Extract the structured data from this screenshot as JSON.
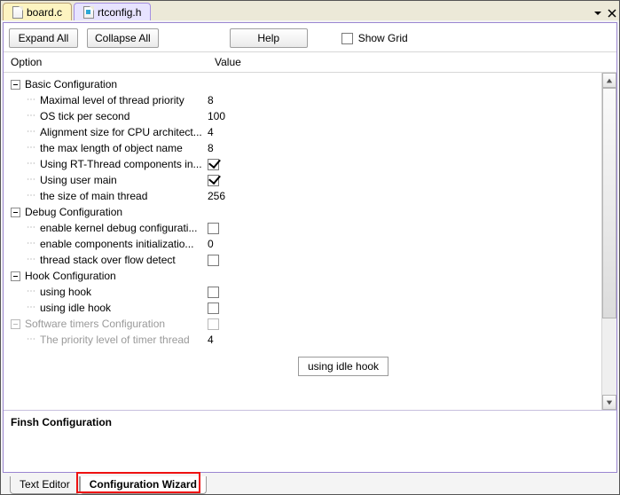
{
  "tabs": {
    "board": "board.c",
    "rtconfig": "rtconfig.h"
  },
  "toolbar": {
    "expand": "Expand All",
    "collapse": "Collapse All",
    "help": "Help",
    "showgrid": "Show Grid"
  },
  "columns": {
    "option": "Option",
    "value": "Value"
  },
  "sections": {
    "basic": {
      "title": "Basic Configuration",
      "items": [
        {
          "label": "Maximal level of thread priority",
          "value": "8"
        },
        {
          "label": "OS tick per second",
          "value": "100"
        },
        {
          "label": "Alignment size for CPU architect...",
          "value": "4"
        },
        {
          "label": "the max length of object name",
          "value": "8"
        },
        {
          "label": "Using RT-Thread components in...",
          "checked": true
        },
        {
          "label": "Using user main",
          "checked": true
        },
        {
          "label": "the size of main thread",
          "value": "256"
        }
      ]
    },
    "debug": {
      "title": "Debug Configuration",
      "items": [
        {
          "label": "enable kernel debug configurati...",
          "checked": false
        },
        {
          "label": "enable components initializatio...",
          "value": "0"
        },
        {
          "label": "thread stack over flow detect",
          "checked": false
        }
      ]
    },
    "hook": {
      "title": "Hook Configuration",
      "items": [
        {
          "label": "using hook",
          "checked": false
        },
        {
          "label": "using idle hook",
          "checked": false
        }
      ]
    },
    "timers": {
      "title": "Software timers Configuration",
      "headerChecked": false,
      "items": [
        {
          "label": "The priority level of timer thread",
          "value": "4"
        }
      ]
    }
  },
  "tooltip": "using idle hook",
  "bottom": {
    "title": "Finsh Configuration"
  },
  "footer": {
    "text_editor": "Text Editor",
    "config_wizard": "Configuration Wizard"
  }
}
